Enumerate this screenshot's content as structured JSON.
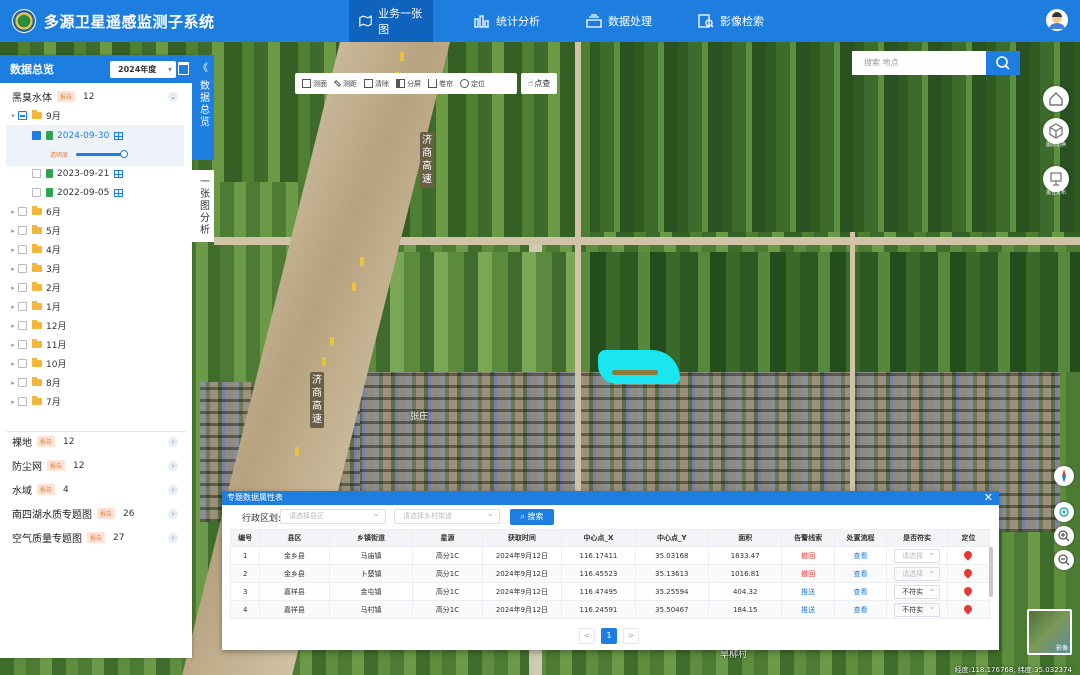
{
  "header": {
    "app_title": "多源卫星遥感监测子系统",
    "nav": [
      {
        "label": "业务一张图",
        "icon": "map-icon",
        "active": true
      },
      {
        "label": "统计分析",
        "icon": "bar-chart-icon",
        "active": false
      },
      {
        "label": "数据处理",
        "icon": "data-process-icon",
        "active": false
      },
      {
        "label": "影像检索",
        "icon": "image-search-icon",
        "active": false
      }
    ]
  },
  "left_panel": {
    "title": "数据总览",
    "year": "2024年度",
    "categories": [
      {
        "name": "黑臭水体",
        "badge": "报告",
        "count": "12"
      },
      {
        "name": "裸地",
        "badge": "报告",
        "count": "12"
      },
      {
        "name": "防尘网",
        "badge": "报告",
        "count": "12"
      },
      {
        "name": "水域",
        "badge": "报告",
        "count": "4"
      },
      {
        "name": "南四湖水质专题图",
        "badge": "报告",
        "count": "26"
      },
      {
        "name": "空气质量专题图",
        "badge": "报告",
        "count": "27"
      }
    ],
    "tree": {
      "open_month": "9月",
      "dates": [
        "2024-09-30",
        "2023-09-21",
        "2022-09-05"
      ],
      "opacity_label": "透明度",
      "opacity_value": 0.85,
      "months": [
        "6月",
        "5月",
        "4月",
        "3月",
        "2月",
        "1月",
        "12月",
        "11月",
        "10月",
        "8月",
        "7月"
      ]
    }
  },
  "vertical_tabs": {
    "overview": "数据总览",
    "onemap": "一张图分析",
    "collapse": "《"
  },
  "toolbar": {
    "tools": [
      "测面",
      "测距",
      "清除",
      "分屏",
      "卷帘",
      "定位"
    ],
    "click_query": "点查"
  },
  "search": {
    "placeholder": "搜索 地点"
  },
  "side_buttons": {
    "home": "",
    "layers": "图层切换",
    "report": "报告发布"
  },
  "map_labels": {
    "highway_chars_1": [
      "济",
      "商",
      "高",
      "速"
    ],
    "highway_chars_2": [
      "济",
      "商",
      "高",
      "速"
    ],
    "village": "张庄",
    "village_bottom": "旱柳村"
  },
  "dialog": {
    "title": "专题数据属性表",
    "filter_label": "行政区划:",
    "district_placeholder": "请选择县区",
    "town_placeholder": "请选择乡村街道",
    "search_label": "搜索",
    "columns": [
      "编号",
      "县区",
      "乡镇街道",
      "星源",
      "获取时间",
      "中心点_X",
      "中心点_Y",
      "面积",
      "告警线索",
      "处置流程",
      "是否符实",
      "定位"
    ],
    "rows": [
      {
        "id": "1",
        "county": "金乡县",
        "town": "马庙镇",
        "sat": "高分1C",
        "time": "2024年9月12日",
        "x": "116.17411",
        "y": "35.03168",
        "area": "1833.47",
        "alert": "撤回",
        "alert_color": "red",
        "flow": "查看",
        "verify": "请选择"
      },
      {
        "id": "2",
        "county": "金乡县",
        "town": "卜楚镇",
        "sat": "高分1C",
        "time": "2024年9月12日",
        "x": "116.45523",
        "y": "35.13613",
        "area": "1016.81",
        "alert": "撤回",
        "alert_color": "red",
        "flow": "查看",
        "verify": "请选择"
      },
      {
        "id": "3",
        "county": "嘉祥县",
        "town": "金屯镇",
        "sat": "高分1C",
        "time": "2024年9月12日",
        "x": "116.47495",
        "y": "35.25594",
        "area": "404.32",
        "alert": "推送",
        "alert_color": "blue",
        "flow": "查看",
        "verify": "不符实"
      },
      {
        "id": "4",
        "county": "嘉祥县",
        "town": "马村镇",
        "sat": "高分1C",
        "time": "2024年9月12日",
        "x": "116.24591",
        "y": "35.50467",
        "area": "184.15",
        "alert": "推送",
        "alert_color": "blue",
        "flow": "查看",
        "verify": "不符实"
      }
    ],
    "page": "1",
    "prev": "<",
    "next": ">"
  },
  "coord_readout": "经度:118.176768, 纬度:35.032374",
  "minimap_label": "影像",
  "colors": {
    "primary": "#1e7ee0",
    "water_highlight": "#19e6f0",
    "alert_red": "#e53935"
  }
}
